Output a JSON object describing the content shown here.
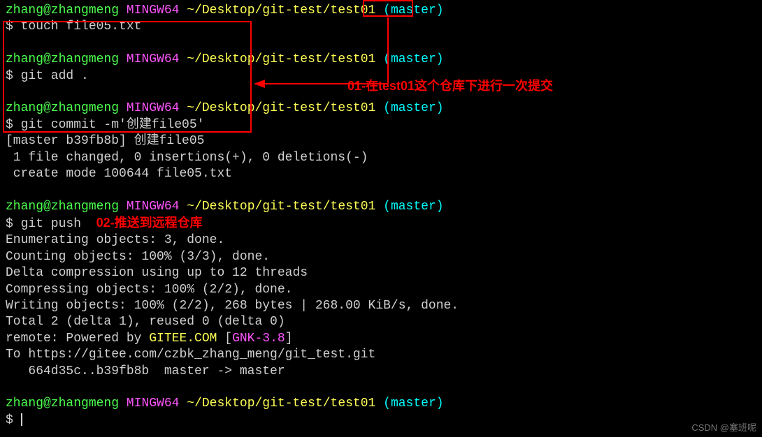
{
  "prompt": {
    "user": "zhang@zhangmeng",
    "shell": "MINGW64",
    "path": "~/Desktop/git-test/test01",
    "branch": "(master)",
    "sep1": " ",
    "sep2": " ",
    "sep3": " "
  },
  "lines": {
    "cmd1": "$ touch file05.txt",
    "cmd2": "$ git add .",
    "cmd3": "$ git commit -m'创建file05'",
    "out_commit1": "[master b39fb8b] 创建file05",
    "out_commit2": " 1 file changed, 0 insertions(+), 0 deletions(-)",
    "out_commit3": " create mode 100644 file05.txt",
    "cmd4": "$ git push  ",
    "push1": "Enumerating objects: 3, done.",
    "push2": "Counting objects: 100% (3/3), done.",
    "push3": "Delta compression using up to 12 threads",
    "push4": "Compressing objects: 100% (2/2), done.",
    "push5": "Writing objects: 100% (2/2), 268 bytes | 268.00 KiB/s, done.",
    "push6": "Total 2 (delta 1), reused 0 (delta 0)",
    "push7a": "remote: Powered by ",
    "push7b": "GITEE.COM",
    "push7c": " [",
    "push7d": "GNK-3.8",
    "push7e": "]",
    "push8": "To https://gitee.com/czbk_zhang_meng/git_test.git",
    "push9": "   664d35c..b39fb8b  master -> master",
    "final_prompt": "$ "
  },
  "annotations": {
    "a1": "01-在test01这个仓库下进行一次提交",
    "a2": "02-推送到远程仓库"
  },
  "watermark": "CSDN @塞班呢"
}
